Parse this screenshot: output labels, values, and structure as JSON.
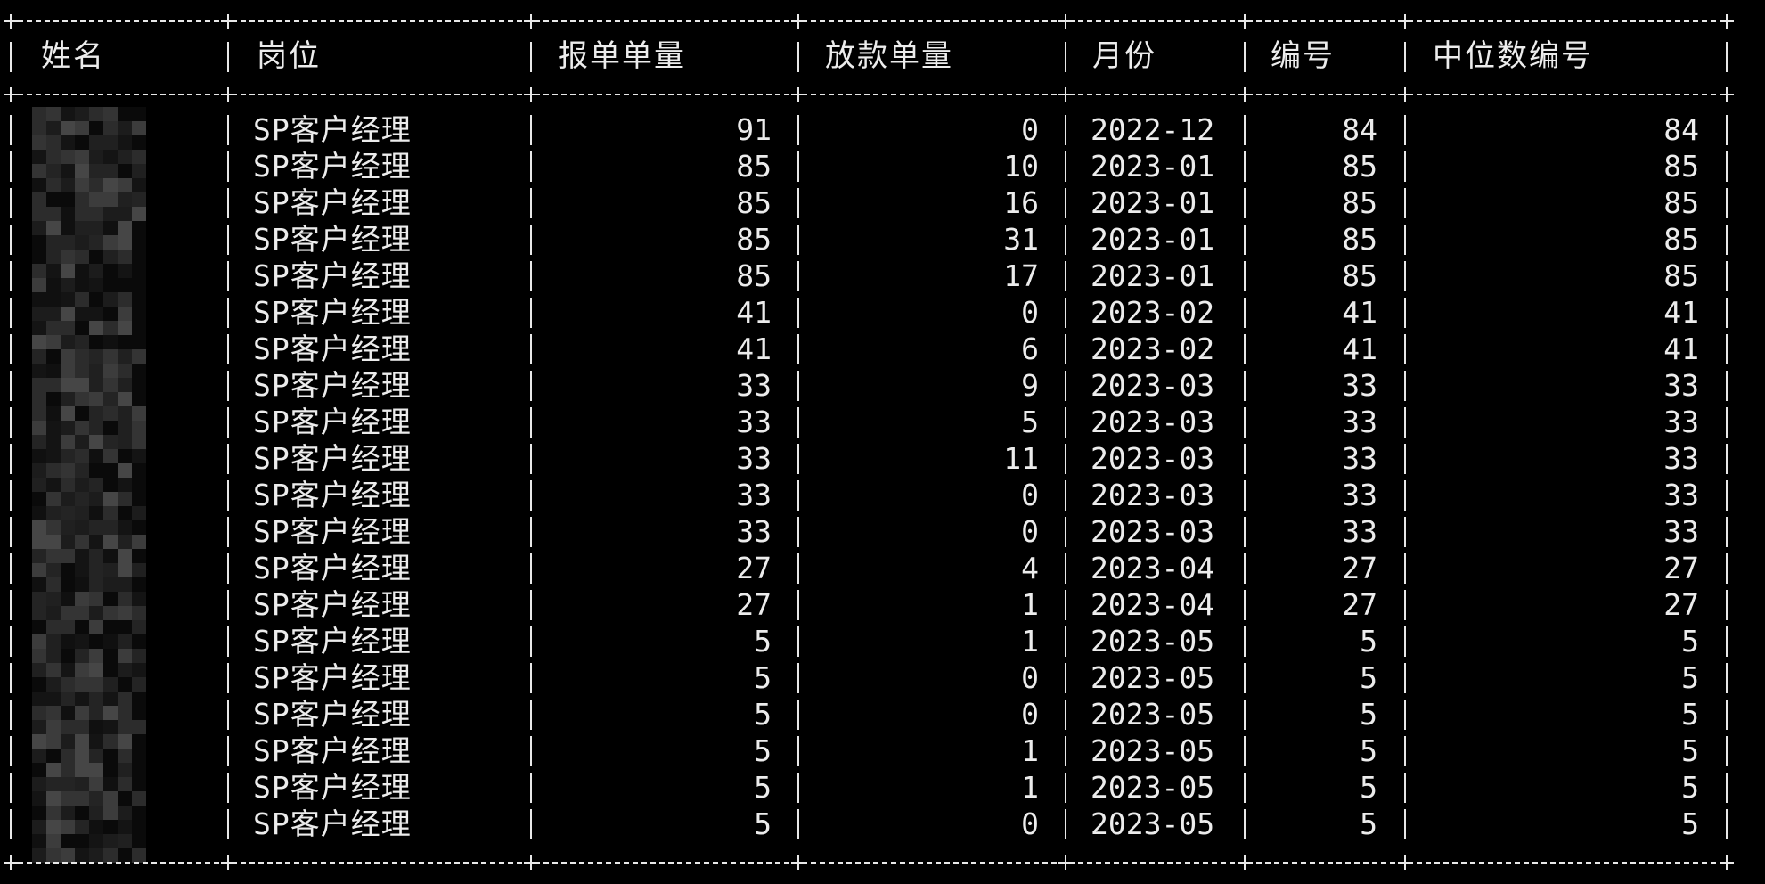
{
  "table": {
    "columns": [
      "姓名",
      "岗位",
      "报单单量",
      "放款单量",
      "月份",
      "编号",
      "中位数编号"
    ],
    "rows": [
      {
        "name": "",
        "position": "SP客户经理",
        "report_count": "91",
        "loan_count": "0",
        "month": "2022-12",
        "code": "84",
        "median_code": "84"
      },
      {
        "name": "",
        "position": "SP客户经理",
        "report_count": "85",
        "loan_count": "10",
        "month": "2023-01",
        "code": "85",
        "median_code": "85"
      },
      {
        "name": "",
        "position": "SP客户经理",
        "report_count": "85",
        "loan_count": "16",
        "month": "2023-01",
        "code": "85",
        "median_code": "85"
      },
      {
        "name": "",
        "position": "SP客户经理",
        "report_count": "85",
        "loan_count": "31",
        "month": "2023-01",
        "code": "85",
        "median_code": "85"
      },
      {
        "name": "",
        "position": "SP客户经理",
        "report_count": "85",
        "loan_count": "17",
        "month": "2023-01",
        "code": "85",
        "median_code": "85"
      },
      {
        "name": "",
        "position": "SP客户经理",
        "report_count": "41",
        "loan_count": "0",
        "month": "2023-02",
        "code": "41",
        "median_code": "41"
      },
      {
        "name": "",
        "position": "SP客户经理",
        "report_count": "41",
        "loan_count": "6",
        "month": "2023-02",
        "code": "41",
        "median_code": "41"
      },
      {
        "name": "",
        "position": "SP客户经理",
        "report_count": "33",
        "loan_count": "9",
        "month": "2023-03",
        "code": "33",
        "median_code": "33"
      },
      {
        "name": "",
        "position": "SP客户经理",
        "report_count": "33",
        "loan_count": "5",
        "month": "2023-03",
        "code": "33",
        "median_code": "33"
      },
      {
        "name": "",
        "position": "SP客户经理",
        "report_count": "33",
        "loan_count": "11",
        "month": "2023-03",
        "code": "33",
        "median_code": "33"
      },
      {
        "name": "",
        "position": "SP客户经理",
        "report_count": "33",
        "loan_count": "0",
        "month": "2023-03",
        "code": "33",
        "median_code": "33"
      },
      {
        "name": "",
        "position": "SP客户经理",
        "report_count": "33",
        "loan_count": "0",
        "month": "2023-03",
        "code": "33",
        "median_code": "33"
      },
      {
        "name": "",
        "position": "SP客户经理",
        "report_count": "27",
        "loan_count": "4",
        "month": "2023-04",
        "code": "27",
        "median_code": "27"
      },
      {
        "name": "",
        "position": "SP客户经理",
        "report_count": "27",
        "loan_count": "1",
        "month": "2023-04",
        "code": "27",
        "median_code": "27"
      },
      {
        "name": "",
        "position": "SP客户经理",
        "report_count": "5",
        "loan_count": "1",
        "month": "2023-05",
        "code": "5",
        "median_code": "5"
      },
      {
        "name": "",
        "position": "SP客户经理",
        "report_count": "5",
        "loan_count": "0",
        "month": "2023-05",
        "code": "5",
        "median_code": "5"
      },
      {
        "name": "",
        "position": "SP客户经理",
        "report_count": "5",
        "loan_count": "0",
        "month": "2023-05",
        "code": "5",
        "median_code": "5"
      },
      {
        "name": "",
        "position": "SP客户经理",
        "report_count": "5",
        "loan_count": "1",
        "month": "2023-05",
        "code": "5",
        "median_code": "5"
      },
      {
        "name": "",
        "position": "SP客户经理",
        "report_count": "5",
        "loan_count": "1",
        "month": "2023-05",
        "code": "5",
        "median_code": "5"
      },
      {
        "name": "",
        "position": "SP客户经理",
        "report_count": "5",
        "loan_count": "0",
        "month": "2023-05",
        "code": "5",
        "median_code": "5"
      }
    ]
  },
  "theme": {
    "background": "#000000",
    "foreground": "#ececec"
  },
  "redaction": {
    "description_icon": "pixelated-name-redaction"
  }
}
